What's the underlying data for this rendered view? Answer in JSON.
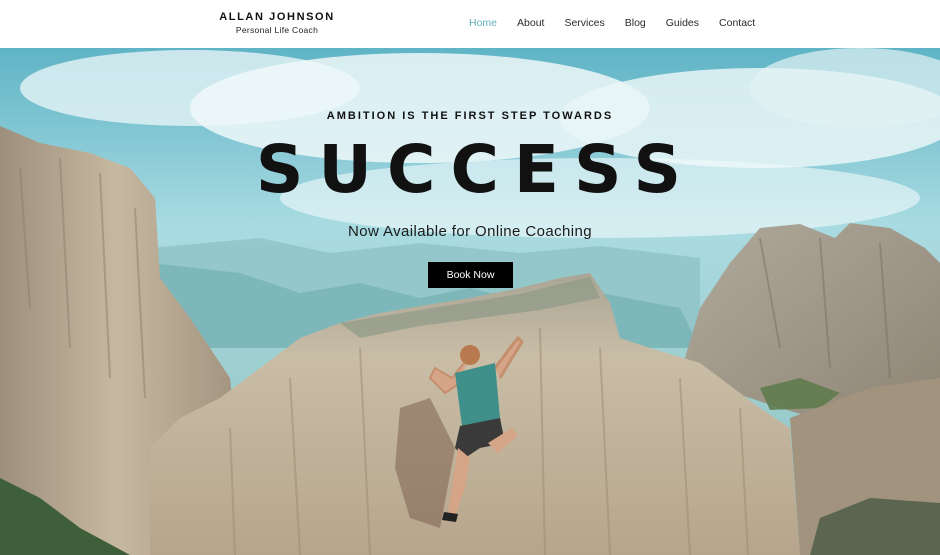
{
  "brand": {
    "name": "ALLAN JOHNSON",
    "tagline": "Personal Life Coach"
  },
  "nav": {
    "items": [
      {
        "label": "Home",
        "active": true
      },
      {
        "label": "About"
      },
      {
        "label": "Services"
      },
      {
        "label": "Blog"
      },
      {
        "label": "Guides"
      },
      {
        "label": "Contact"
      }
    ]
  },
  "hero": {
    "eyebrow": "AMBITION IS THE FIRST STEP TOWARDS",
    "headline": "SUCCESS",
    "subheadline": "Now Available for Online Coaching",
    "cta_label": "Book Now"
  },
  "colors": {
    "accent": "#5fb0b7",
    "button_bg": "#000000",
    "text": "#111111"
  }
}
